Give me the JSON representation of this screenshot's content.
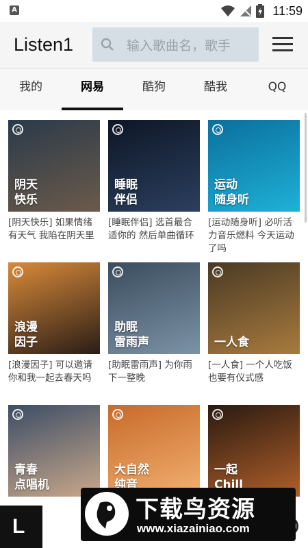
{
  "status_bar": {
    "notification_letter": "A",
    "time": "11:59",
    "icons": [
      "wifi-icon",
      "signal-icon",
      "battery-icon"
    ]
  },
  "app_bar": {
    "title": "Listen1",
    "search_placeholder": "输入歌曲名，歌手",
    "icons": [
      "search-icon",
      "menu-icon"
    ]
  },
  "tabs": [
    {
      "label": "我的",
      "active": false
    },
    {
      "label": "网易",
      "active": true
    },
    {
      "label": "酷狗",
      "active": false
    },
    {
      "label": "酷我",
      "active": false
    },
    {
      "label": "QQ",
      "active": false
    }
  ],
  "playlists": [
    {
      "cover_label": "阴天\n快乐",
      "description": "[阴天快乐] 如果情绪有天气 我陷在阴天里",
      "colors": [
        "#2a3a4a",
        "#6b5a4a"
      ]
    },
    {
      "cover_label": "睡眠\n伴侣",
      "description": "[睡眠伴侣] 选首最合适你的 然后单曲循环",
      "colors": [
        "#0e1626",
        "#2b3f5e"
      ]
    },
    {
      "cover_label": "运动\n随身听",
      "description": "[运动随身听] 必听活力音乐燃料 今天运动了吗",
      "colors": [
        "#0a6f9e",
        "#1fb1d6"
      ]
    },
    {
      "cover_label": "浪漫\n因子",
      "description": "[浪漫因子] 可以邀请你和我一起去春天吗",
      "colors": [
        "#d98a3a",
        "#2a1d16"
      ]
    },
    {
      "cover_label": "助眠\n雷雨声",
      "description": "[助眠雷雨声] 为你雨下一整晚",
      "colors": [
        "#3a4d5e",
        "#7c92a6"
      ]
    },
    {
      "cover_label": "一人食",
      "description": "[一人食] 一个人吃饭也要有仪式感",
      "colors": [
        "#4a3a24",
        "#a87b3e"
      ]
    },
    {
      "cover_label": "青春\n点唱机",
      "description": "",
      "colors": [
        "#3c4d66",
        "#c9a88a"
      ]
    },
    {
      "cover_label": "大自然\n纯音",
      "description": "",
      "colors": [
        "#c86a2a",
        "#f2b070"
      ]
    },
    {
      "cover_label": "一起\nChill",
      "description": "",
      "colors": [
        "#2a1a10",
        "#b0602a"
      ]
    }
  ],
  "player": {
    "logo_glyph": "L"
  },
  "watermark": {
    "title": "下载鸟资源",
    "url": "www.xiazainiao.com"
  }
}
